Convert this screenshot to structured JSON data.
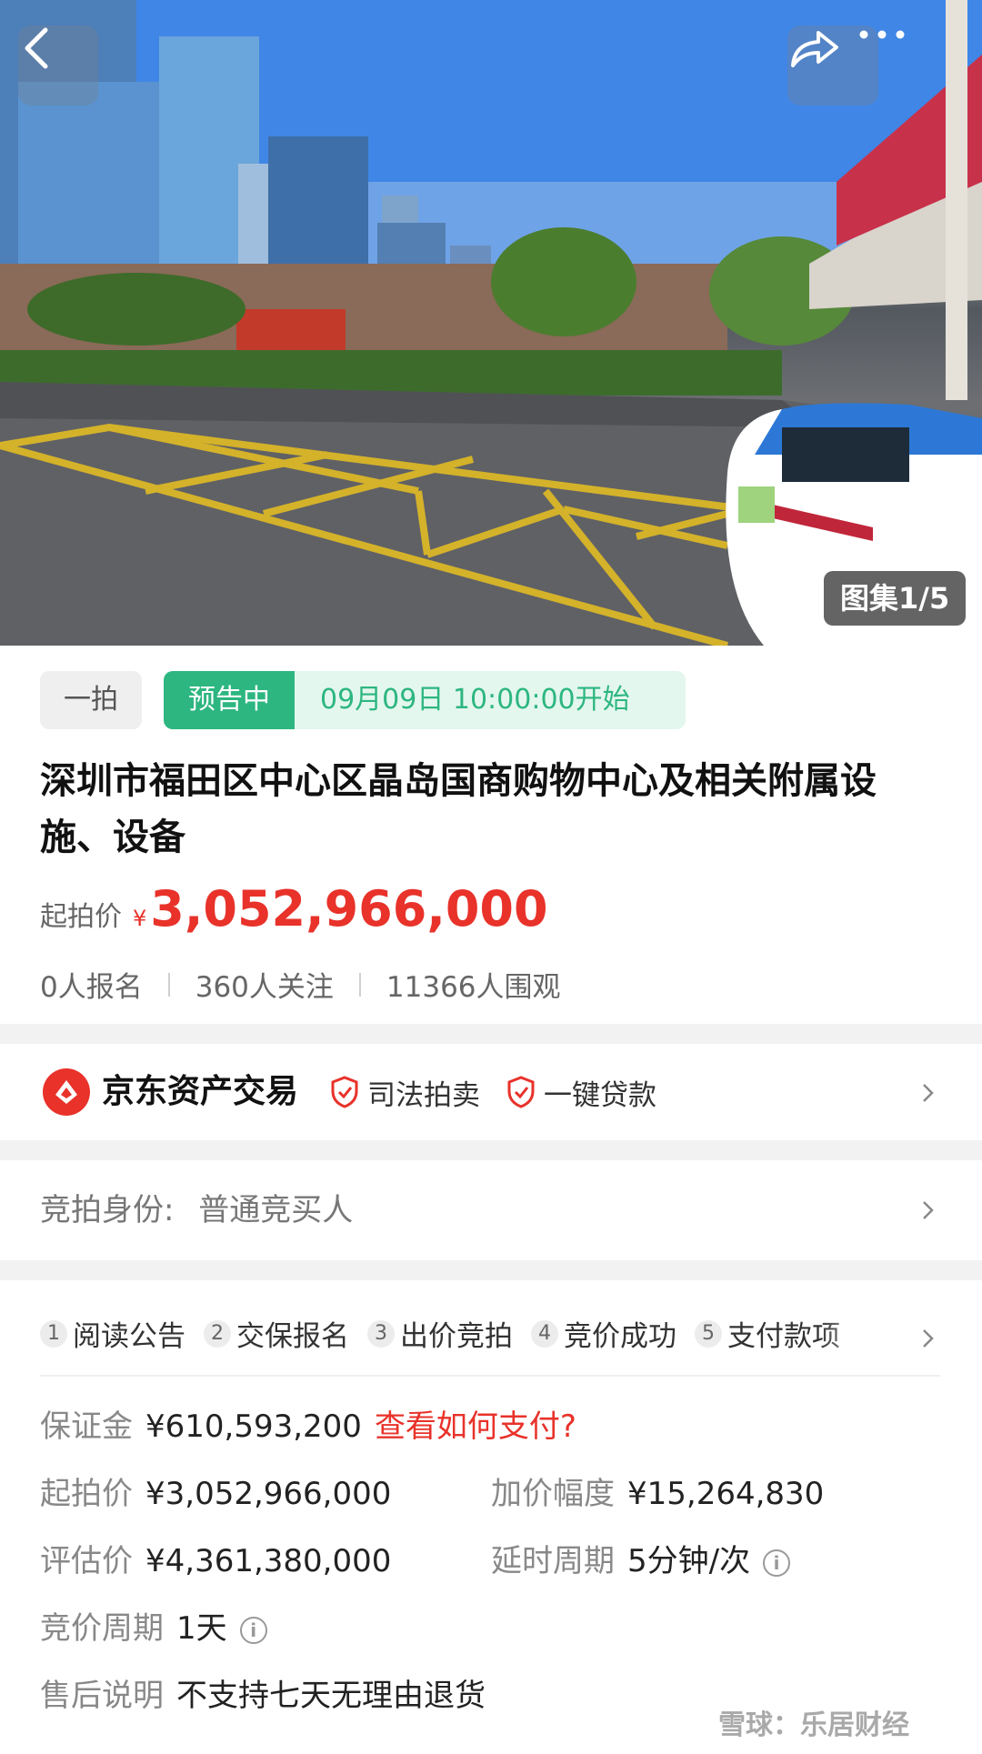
{
  "hero": {
    "gallery_badge": "图集1/5",
    "back_icon": "chevron-left-icon",
    "share_icon": "share-icon",
    "more_icon": "more-icon"
  },
  "auction": {
    "round_tag": "一拍",
    "status_tag": "预告中",
    "start_time": "09月09日 10:00:00开始",
    "title": "深圳市福田区中心区晶岛国商购物中心及相关附属设施、设备",
    "price_label": "起拍价",
    "price_currency": "¥",
    "price_value": "3,052,966,000",
    "stats": [
      "0人报名",
      "360人关注",
      "11366人围观"
    ]
  },
  "platform": {
    "name": "京东资产交易",
    "badges": [
      "司法拍卖",
      "一键贷款"
    ]
  },
  "bidder": {
    "label": "竞拍身份:",
    "value": "普通竞买人"
  },
  "steps": [
    {
      "num": "1",
      "label": "阅读公告"
    },
    {
      "num": "2",
      "label": "交保报名"
    },
    {
      "num": "3",
      "label": "出价竞拍"
    },
    {
      "num": "4",
      "label": "竞价成功"
    },
    {
      "num": "5",
      "label": "支付款项"
    }
  ],
  "details": {
    "deposit_label": "保证金",
    "deposit_value": "¥610,593,200",
    "deposit_link": "查看如何支付?",
    "start_price_label": "起拍价",
    "start_price_value": "¥3,052,966,000",
    "increment_label": "加价幅度",
    "increment_value": "¥15,264,830",
    "appraisal_label": "评估价",
    "appraisal_value": "¥4,361,380,000",
    "delay_label": "延时周期",
    "delay_value": "5分钟/次",
    "cycle_label": "竞价周期",
    "cycle_value": "1天",
    "aftersale_label": "售后说明",
    "aftersale_value": "不支持七天无理由退货"
  },
  "watermark": "雪球：乐居财经",
  "colors": {
    "accent_red": "#e8322a",
    "accent_green": "#2db680"
  }
}
